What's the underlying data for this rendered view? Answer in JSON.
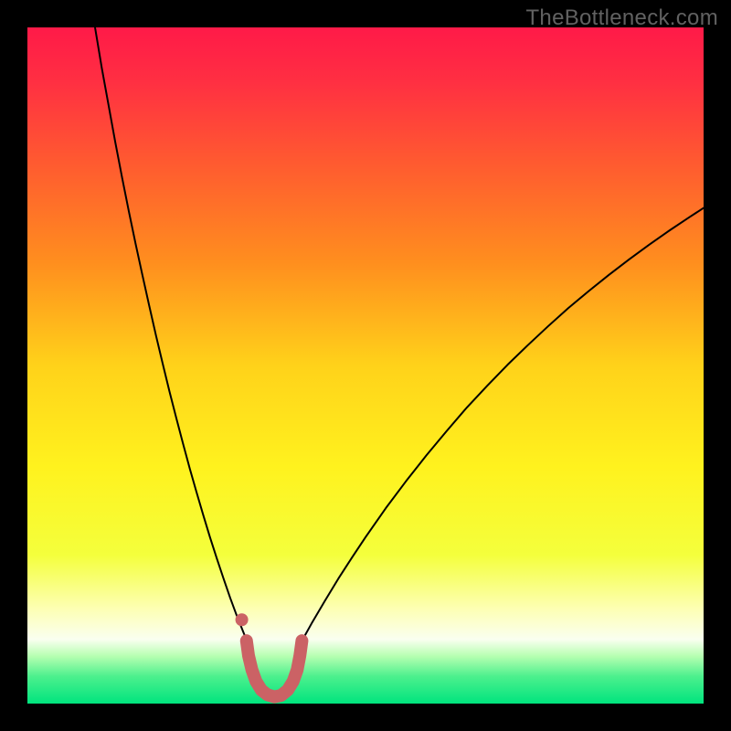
{
  "watermark": "TheBottleneck.com",
  "chart_data": {
    "type": "line",
    "title": "",
    "xlabel": "",
    "ylabel": "",
    "xlim": [
      0,
      100
    ],
    "ylim": [
      0,
      100
    ],
    "background_gradient": {
      "stops": [
        {
          "offset": 0.0,
          "color": "#ff1a48"
        },
        {
          "offset": 0.08,
          "color": "#ff2f42"
        },
        {
          "offset": 0.2,
          "color": "#ff5a30"
        },
        {
          "offset": 0.35,
          "color": "#ff8f1e"
        },
        {
          "offset": 0.5,
          "color": "#ffd21a"
        },
        {
          "offset": 0.65,
          "color": "#fff21e"
        },
        {
          "offset": 0.78,
          "color": "#f4ff3c"
        },
        {
          "offset": 0.86,
          "color": "#fdffb4"
        },
        {
          "offset": 0.905,
          "color": "#fafff0"
        },
        {
          "offset": 0.93,
          "color": "#b6ffb1"
        },
        {
          "offset": 0.96,
          "color": "#4cf08d"
        },
        {
          "offset": 1.0,
          "color": "#00e47e"
        }
      ]
    },
    "series": [
      {
        "name": "left-branch",
        "stroke": "#000000",
        "stroke_width": 2,
        "points": [
          {
            "x": 10.0,
            "y": 100.0
          },
          {
            "x": 11.0,
            "y": 94.0
          },
          {
            "x": 12.0,
            "y": 88.5
          },
          {
            "x": 13.0,
            "y": 83.0
          },
          {
            "x": 14.0,
            "y": 77.8
          },
          {
            "x": 15.0,
            "y": 72.8
          },
          {
            "x": 16.0,
            "y": 68.0
          },
          {
            "x": 17.0,
            "y": 63.4
          },
          {
            "x": 18.0,
            "y": 58.9
          },
          {
            "x": 19.0,
            "y": 54.5
          },
          {
            "x": 20.0,
            "y": 50.3
          },
          {
            "x": 21.0,
            "y": 46.2
          },
          {
            "x": 22.0,
            "y": 42.3
          },
          {
            "x": 23.0,
            "y": 38.5
          },
          {
            "x": 24.0,
            "y": 34.8
          },
          {
            "x": 25.0,
            "y": 31.3
          },
          {
            "x": 26.0,
            "y": 27.9
          },
          {
            "x": 27.0,
            "y": 24.6
          },
          {
            "x": 28.0,
            "y": 21.5
          },
          {
            "x": 29.0,
            "y": 18.5
          },
          {
            "x": 30.0,
            "y": 15.6
          },
          {
            "x": 31.0,
            "y": 12.9
          },
          {
            "x": 32.0,
            "y": 10.4
          },
          {
            "x": 32.5,
            "y": 9.2
          }
        ]
      },
      {
        "name": "right-branch",
        "stroke": "#000000",
        "stroke_width": 2,
        "points": [
          {
            "x": 40.5,
            "y": 9.2
          },
          {
            "x": 41.0,
            "y": 10.0
          },
          {
            "x": 42.0,
            "y": 11.8
          },
          {
            "x": 44.0,
            "y": 15.2
          },
          {
            "x": 46.0,
            "y": 18.5
          },
          {
            "x": 48.0,
            "y": 21.6
          },
          {
            "x": 50.0,
            "y": 24.6
          },
          {
            "x": 53.0,
            "y": 28.9
          },
          {
            "x": 56.0,
            "y": 32.9
          },
          {
            "x": 59.0,
            "y": 36.7
          },
          {
            "x": 62.0,
            "y": 40.3
          },
          {
            "x": 65.0,
            "y": 43.8
          },
          {
            "x": 68.0,
            "y": 47.0
          },
          {
            "x": 71.0,
            "y": 50.1
          },
          {
            "x": 74.0,
            "y": 53.0
          },
          {
            "x": 77.0,
            "y": 55.8
          },
          {
            "x": 80.0,
            "y": 58.5
          },
          {
            "x": 83.0,
            "y": 61.0
          },
          {
            "x": 86.0,
            "y": 63.4
          },
          {
            "x": 89.0,
            "y": 65.7
          },
          {
            "x": 92.0,
            "y": 67.9
          },
          {
            "x": 95.0,
            "y": 70.0
          },
          {
            "x": 98.0,
            "y": 72.0
          },
          {
            "x": 100.0,
            "y": 73.3
          }
        ]
      },
      {
        "name": "highlight-band",
        "stroke": "#cb6265",
        "stroke_width": 14,
        "points": [
          {
            "x": 32.4,
            "y": 9.3
          },
          {
            "x": 32.7,
            "y": 7.1
          },
          {
            "x": 33.2,
            "y": 5.0
          },
          {
            "x": 33.8,
            "y": 3.3
          },
          {
            "x": 34.6,
            "y": 2.0
          },
          {
            "x": 35.5,
            "y": 1.3
          },
          {
            "x": 36.5,
            "y": 1.0
          },
          {
            "x": 37.5,
            "y": 1.2
          },
          {
            "x": 38.5,
            "y": 2.0
          },
          {
            "x": 39.3,
            "y": 3.3
          },
          {
            "x": 39.9,
            "y": 5.0
          },
          {
            "x": 40.3,
            "y": 7.1
          },
          {
            "x": 40.6,
            "y": 9.3
          }
        ]
      },
      {
        "name": "marker-dot",
        "type": "point",
        "fill": "#cb6265",
        "radius": 7,
        "x": 31.7,
        "y": 12.4
      }
    ]
  }
}
